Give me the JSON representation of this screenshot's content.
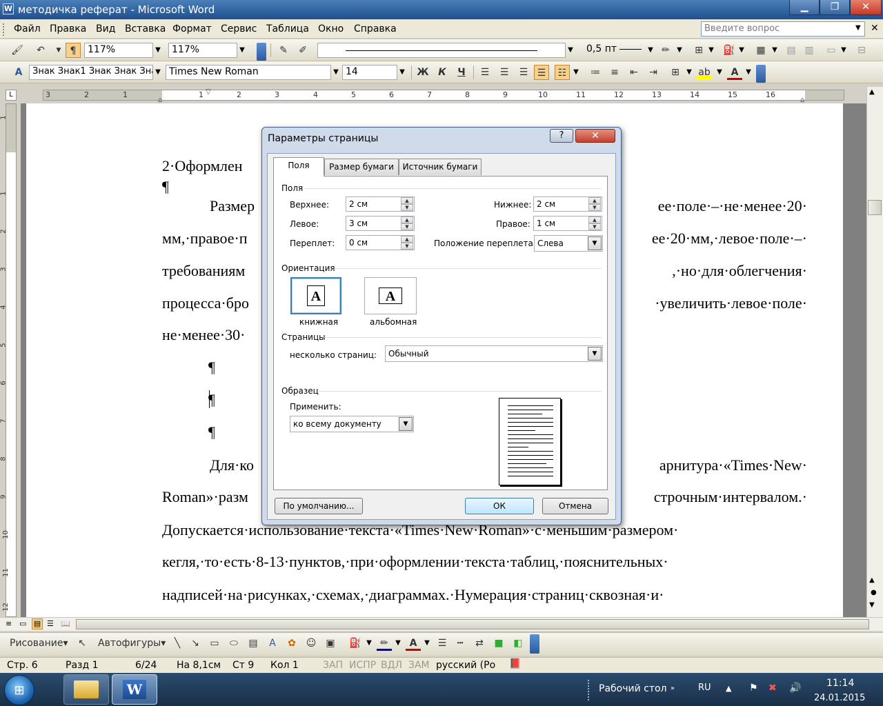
{
  "window": {
    "title": "методичка реферат - Microsoft Word",
    "app_icon": "W",
    "min": "▁",
    "max": "❐",
    "close": "✕"
  },
  "menu": {
    "items": [
      "Файл",
      "Правка",
      "Вид",
      "Вставка",
      "Формат",
      "Сервис",
      "Таблица",
      "Окно",
      "Справка"
    ],
    "ask_placeholder": "Введите вопрос"
  },
  "toolbar1": {
    "zoom1": "117%",
    "zoom2": "117%",
    "line_weight": "0,5 пт"
  },
  "toolbar2": {
    "style": "Знак Знак1 Знак Знак Зна",
    "font": "Times New Roman",
    "size": "14",
    "bold": "Ж",
    "italic": "К",
    "underline": "Ч"
  },
  "ruler": {
    "h_numbers": [
      "3",
      "2",
      "1",
      "1",
      "2",
      "3",
      "4",
      "5",
      "6",
      "7",
      "8",
      "9",
      "10",
      "11",
      "12",
      "13",
      "14",
      "15",
      "16"
    ],
    "v_numbers": [
      "1",
      "1",
      "2",
      "3",
      "4",
      "5",
      "6",
      "7",
      "8",
      "9",
      "10",
      "11",
      "12"
    ]
  },
  "document": {
    "lines": [
      "2·Оформлен",
      "¶",
      "Размер",
      "мм,·правое·п",
      "требованиям",
      "процесса·бро",
      "не·менее·30·",
      "¶",
      "¶",
      "¶",
      "Для·ко",
      "Roman»·разм",
      "Допускается·использование·текста·«Times·New·Roman»·с·меньшим·размером·",
      "кегля,·то·есть·8-13·пунктов,·при·оформлении·текста·таблиц,·пояснительных·",
      "надписей·на·рисунках,·схемах,·диаграммах.·Нумерация·страниц·сквозная·и·"
    ],
    "right_fragments": [
      "ее·поле·–·не·менее·20·",
      "ее·20·мм,·левое·поле·–·",
      ",·но·для·облегчения·",
      "·увеличить·левое·поле·",
      "арнитура·«Times·New·",
      "строчным·интервалом.·"
    ]
  },
  "dialog": {
    "title": "Параметры страницы",
    "help": "?",
    "close": "✕",
    "tabs": [
      "Поля",
      "Размер бумаги",
      "Источник бумаги"
    ],
    "fields_group": "Поля",
    "top_label": "Верхнее:",
    "top_value": "2 см",
    "bottom_label": "Нижнее:",
    "bottom_value": "2 см",
    "left_label": "Левое:",
    "left_value": "3 см",
    "right_label": "Правое:",
    "right_value": "1 см",
    "gutter_label": "Переплет:",
    "gutter_value": "0 см",
    "gutter_pos_label": "Положение переплета:",
    "gutter_pos_value": "Слева",
    "orientation_group": "Ориентация",
    "portrait": "книжная",
    "landscape": "альбомная",
    "orientation_glyph": "A",
    "pages_group": "Страницы",
    "multiple_pages_label": "несколько страниц:",
    "multiple_pages_value": "Обычный",
    "sample_group": "Образец",
    "apply_label": "Применить:",
    "apply_value": "ко всему документу",
    "default_button": "По умолчанию...",
    "ok_button": "ОК",
    "cancel_button": "Отмена"
  },
  "drawing": {
    "draw": "Рисование",
    "autoshapes": "Автофигуры"
  },
  "status": {
    "page": "Стр. 6",
    "section": "Разд 1",
    "pages": "6/24",
    "at": "На 8,1см",
    "line": "Ст 9",
    "col": "Кол 1",
    "rec": "ЗАП",
    "trk": "ИСПР",
    "ext": "ВДЛ",
    "ovr": "ЗАМ",
    "lang": "русский (Ро"
  },
  "taskbar": {
    "desktop": "Рабочий стол",
    "lang": "RU",
    "time": "11:14",
    "date": "24.01.2015"
  }
}
